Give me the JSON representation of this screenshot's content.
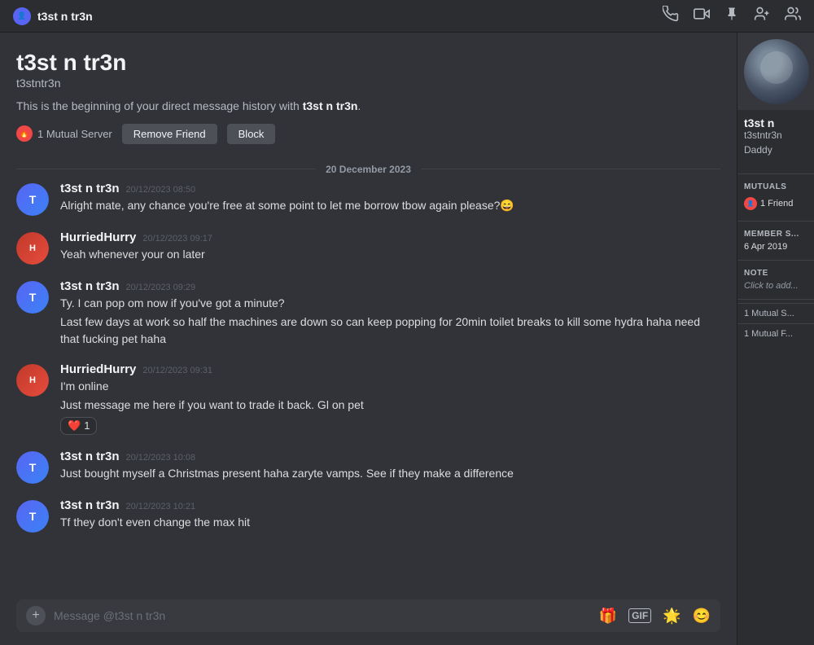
{
  "titlebar": {
    "username": "t3st n tr3n",
    "icons": [
      "phone-icon",
      "video-icon",
      "pin-icon",
      "add-member-icon",
      "members-icon"
    ]
  },
  "chat": {
    "header": {
      "display_name": "t3st n tr3n",
      "username": "t3stntr3n",
      "description_prefix": "This is the beginning of your direct message history with ",
      "description_user": "t3st n tr3n",
      "description_suffix": ".",
      "mutual_server": "1 Mutual Server",
      "remove_friend_label": "Remove Friend",
      "block_label": "Block"
    },
    "date_divider": "20 December 2023",
    "messages": [
      {
        "id": "msg1",
        "username": "t3st n tr3n",
        "timestamp": "20/12/2023 08:50",
        "lines": [
          "Alright mate, any chance you're free at some point to let me borrow tbow again please?😄"
        ],
        "avatar_type": "t3st"
      },
      {
        "id": "msg2",
        "username": "HurriedHurry",
        "timestamp": "20/12/2023 09:17",
        "lines": [
          "Yeah whenever your on later"
        ],
        "avatar_type": "hurried"
      },
      {
        "id": "msg3",
        "username": "t3st n tr3n",
        "timestamp": "20/12/2023 09:29",
        "lines": [
          "Ty. I can pop om now if you've got a minute?",
          "Last few days at work so half the machines are down so can keep popping for 20min toilet breaks to kill some hydra haha need that fucking pet haha"
        ],
        "avatar_type": "t3st"
      },
      {
        "id": "msg4",
        "username": "HurriedHurry",
        "timestamp": "20/12/2023 09:31",
        "lines": [
          "I'm online",
          "Just message me here if you want to trade it back. Gl on pet"
        ],
        "reaction": {
          "emoji": "❤️",
          "count": "1"
        },
        "avatar_type": "hurried"
      },
      {
        "id": "msg5",
        "username": "t3st n tr3n",
        "timestamp": "20/12/2023 10:08",
        "lines": [
          "Just bought myself a Christmas present haha zaryte vamps. See if they make a difference"
        ],
        "avatar_type": "t3st"
      },
      {
        "id": "msg6",
        "username": "t3st n tr3n",
        "timestamp": "20/12/2023 10:21",
        "lines": [
          "Tf they don't even change the max hit"
        ],
        "avatar_type": "t3st"
      }
    ],
    "input_placeholder": "Message @t3st n tr3n"
  },
  "sidebar": {
    "display_name": "t3st n",
    "username_line1": "t3stntr3n",
    "tag": "Daddy",
    "mutuals_label": "MUTUALS",
    "mutuals_friend": "1 Friend",
    "member_since_label": "MEMBER S...",
    "member_since_value": "6 Apr 2019",
    "note_label": "NOTE",
    "note_placeholder": "Click to add...",
    "mutual_server_label": "1 Mutual S...",
    "mutual_friend_label": "1 Mutual F..."
  }
}
